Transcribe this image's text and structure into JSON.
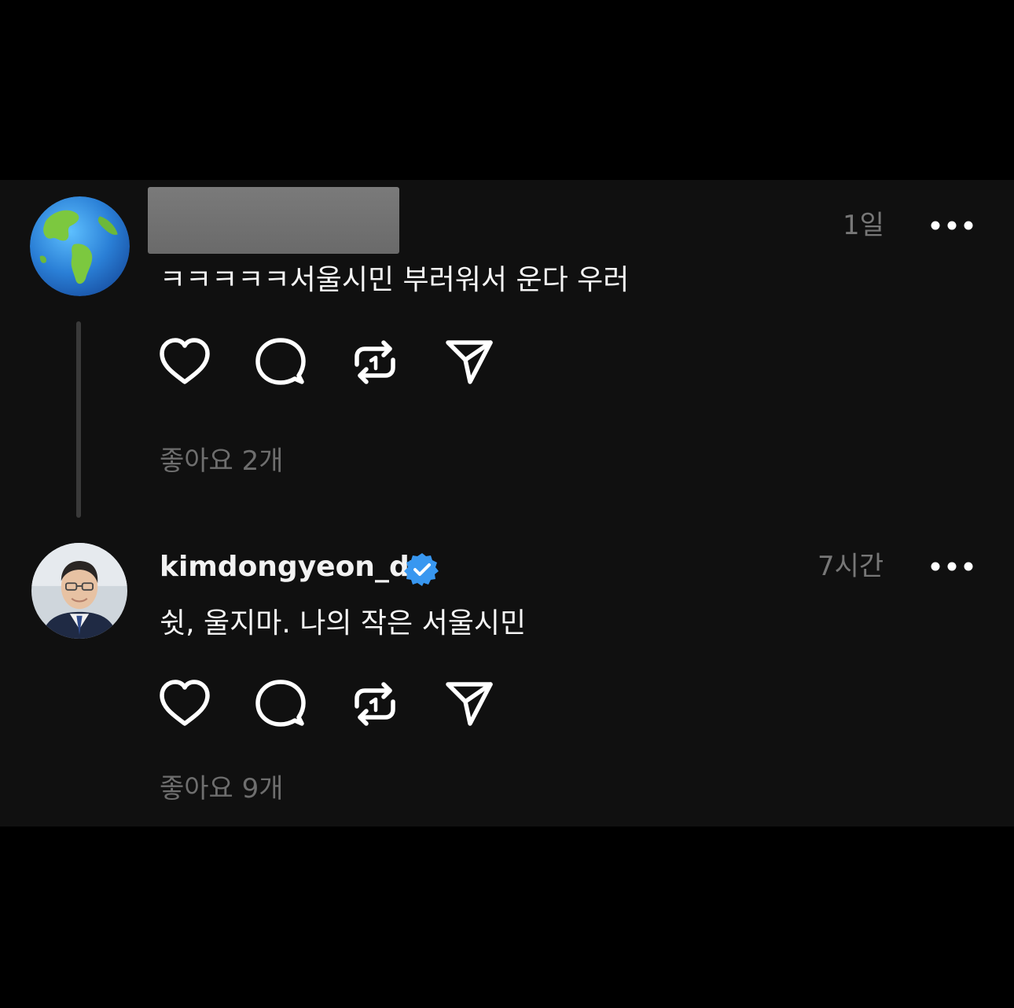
{
  "post1": {
    "avatar": "globe-icon",
    "time": "1일",
    "text": "ㅋㅋㅋㅋㅋ서울시민 부러워서 운다 우러",
    "likes": "좋아요 2개"
  },
  "post2": {
    "username": "kimdongyeon_dy",
    "time": "7시간",
    "text": "쉿, 울지마. 나의 작은 서울시민",
    "likes": "좋아요 9개"
  },
  "icons": {
    "like": "heart-icon",
    "reply": "comment-icon",
    "repost": "repost-icon",
    "share": "send-icon",
    "more": "more-icon",
    "verified": "verified-badge-icon"
  },
  "colors": {
    "background": "#101010",
    "outer": "#000000",
    "verified": "#3897f0",
    "muted": "#777777"
  }
}
